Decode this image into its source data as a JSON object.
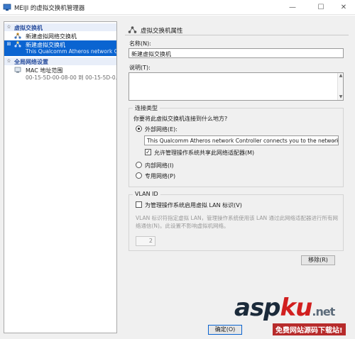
{
  "window": {
    "title": "MEIJI 的虚拟交换机管理器",
    "min": "—",
    "max": "☐",
    "close": "✕"
  },
  "tree": {
    "header1": "虚拟交换机",
    "item_new_network_switch": "新建虚拟网络交换机",
    "item_new_switch": {
      "title": "新建虚拟交换机",
      "subtitle": "This Qualcomm Atheros network C..."
    },
    "header2": "全局网络设置",
    "item_mac": {
      "title": "MAC 地址范围",
      "subtitle": "00-15-5D-00-08-00 到 00-15-5D-0..."
    }
  },
  "panel": {
    "heading": "虚拟交换机属性",
    "name_label": "名称(N):",
    "name_value": "新建虚拟交换机",
    "desc_label": "说明(T):",
    "desc_value": "",
    "connection": {
      "title": "连接类型",
      "question": "你要将此虚拟交换机连接到什么地方?",
      "external_label": "外部网络(E):",
      "adapter_value": "This Qualcomm Atheros network Controller connects you to the network.",
      "allow_share_label": "允许管理操作系统共享此网络适配器(M)",
      "internal_label": "内部网络(I)",
      "private_label": "专用网络(P)"
    },
    "vlan": {
      "title": "VLAN ID",
      "enable_label": "为管理操作系统启用虚拟 LAN 标识(V)",
      "note": "VLAN 标识符指定虚拟 LAN，管理操作系统使用该 LAN 通过此网络适配器进行所有网络通信(N)。此设置不影响虚拟机网络。",
      "id_value": "2"
    },
    "remove_button": "移除(R)"
  },
  "footer": {
    "ok_button": "确定(O)"
  },
  "watermark": {
    "logo_a": "asp",
    "logo_k": "ku",
    "logo_net": ".net",
    "slogan": "免费网站源码下载站!"
  },
  "colors": {
    "selection": "#0a64d1",
    "header_text": "#2a4f9e"
  }
}
